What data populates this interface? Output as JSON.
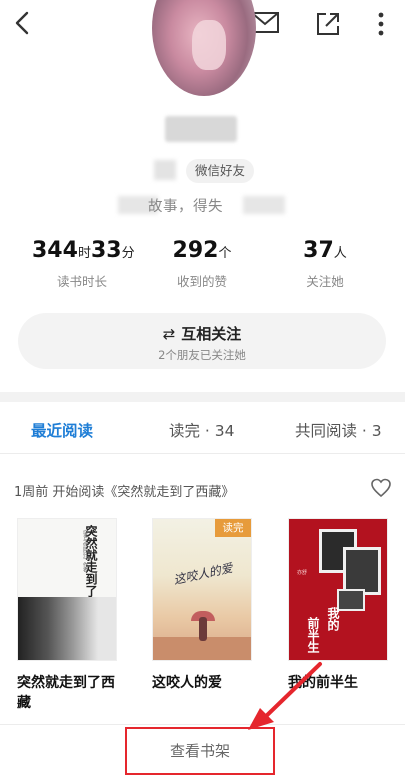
{
  "toolbar": {
    "back_icon": "chevron-left-icon",
    "mail_icon": "envelope-icon",
    "share_icon": "share-icon",
    "more_icon": "more-vertical-icon"
  },
  "profile": {
    "friend_badge": "微信好友",
    "bio": "故事，得失"
  },
  "stats": [
    {
      "value_main": "344",
      "unit_main": "时",
      "value_sub": "33",
      "unit_sub": "分",
      "label": "读书时长"
    },
    {
      "value_main": "292",
      "unit_main": "个",
      "label": "收到的赞"
    },
    {
      "value_main": "37",
      "unit_main": "人",
      "label": "关注她"
    }
  ],
  "follow": {
    "icon": "exchange-icon",
    "label": "互相关注",
    "sub": "2个朋友已关注她"
  },
  "tabs": [
    {
      "label": "最近阅读",
      "active": true
    },
    {
      "label": "读完 · 34"
    },
    {
      "label": "共同阅读 · 3"
    }
  ],
  "activity": {
    "text": "1周前 开始阅读《突然就走到了西藏》",
    "like_icon": "heart-icon"
  },
  "books": [
    {
      "title": "突然就走到了西藏",
      "cover_title": "突然就走到了西藏",
      "cover_sub": "《谁与你同行》作者"
    },
    {
      "title": "这咬人的爱",
      "badge": "读完",
      "cover_title": "这咬人的爱"
    },
    {
      "title": "我的前半生",
      "cover_title_a": "我的",
      "cover_title_b": "前半生",
      "cover_sub": "亦舒"
    }
  ],
  "bottom": {
    "shelf_label": "查看书架"
  },
  "colors": {
    "accent": "#1f7ed6",
    "highlight": "#e5262d",
    "badge": "#e79b3b"
  }
}
